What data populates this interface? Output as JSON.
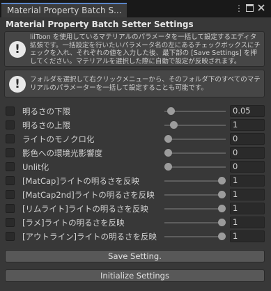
{
  "window": {
    "tab_title": "Material Property Batch S...",
    "header_title": "Material Property Batch Setter Settings"
  },
  "help": [
    {
      "icon": "!",
      "text": "lilToon を使用しているマテリアルのパラメータを一括して設定するエディタ拡張です。一括設定を行いたいパラメータ名の左にあるチェックボックスにチェックを入れ、それぞれの値を入力した後、最下部の [Save Settings] を押してください。マテリアルを選択した際に自動で設定が反映されます。"
    },
    {
      "icon": "!",
      "text": "フォルダを選択して右クリックメニューから、そのフォルダ下のすべてのマテリアルのパラメーターを一括して設定することも可能です。"
    }
  ],
  "params": [
    {
      "label": "明るさの下限",
      "value": "0.05",
      "level": 0.05,
      "checked": false
    },
    {
      "label": "明るさの上限",
      "value": "1",
      "level": 0.1,
      "checked": false
    },
    {
      "label": "ライトのモノクロ化",
      "value": "0",
      "level": 0.0,
      "checked": false
    },
    {
      "label": "影色への環境光影響度",
      "value": "0",
      "level": 0.0,
      "checked": false
    },
    {
      "label": "Unlit化",
      "value": "0",
      "level": 0.0,
      "checked": false
    },
    {
      "label": "[MatCap]ライトの明るさを反映",
      "value": "1",
      "level": 1.0,
      "checked": false
    },
    {
      "label": "[MatCap2nd]ライトの明るさを反映",
      "value": "1",
      "level": 1.0,
      "checked": false
    },
    {
      "label": "[リムライト]ライトの明るさを反映",
      "value": "1",
      "level": 1.0,
      "checked": false
    },
    {
      "label": "[ラメ]ライトの明るさを反映",
      "value": "1",
      "level": 1.0,
      "checked": false
    },
    {
      "label": "[アウトライン]ライトの明るさを反映",
      "value": "1",
      "level": 1.0,
      "checked": false
    }
  ],
  "buttons": {
    "save": "Save Setting.",
    "initialize": "Initialize Settings"
  },
  "icons": [
    "menu-kebab-icon",
    "maximize-icon",
    "close-icon",
    "warning-icon"
  ]
}
